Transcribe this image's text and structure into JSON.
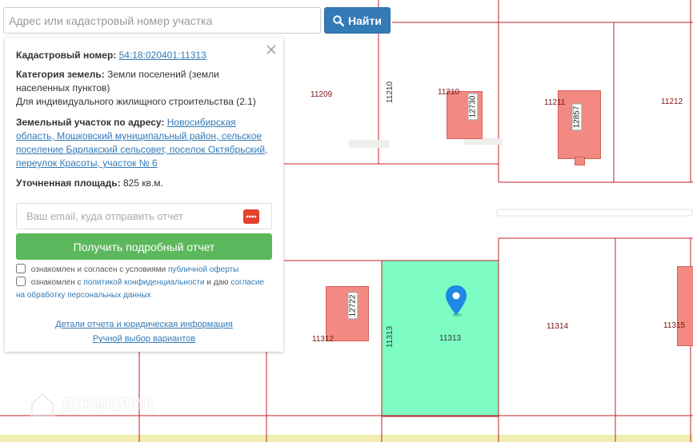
{
  "search": {
    "placeholder": "Адрес или кадастровый номер участка",
    "button_label": "Найти"
  },
  "panel": {
    "cadastral_label": "Кадастровый номер:",
    "cadastral_value": "54:18:020401:11313",
    "category_label": "Категория земель:",
    "category_value": "Земли поселений (земли населенных пунктов)",
    "category_purpose": "Для индивидуального жилищного строительства (2.1)",
    "address_label": "Земельный участок по адресу:",
    "address_value": "Новосибирская область, Мошковский муниципальный район, сельское поселение Барлакский сельсовет, поселок Октябрьский, переулок Красоты, участок № 6",
    "area_label": "Уточненная площадь:",
    "area_value": "825 кв.м.",
    "email_placeholder": "Ваш email, куда отправить отчет",
    "report_button": "Получить подробный отчет",
    "consent1_text": "ознакомлен и согласен с условиями",
    "consent1_link": "публичной оферты",
    "consent2_text": "ознакомлен с",
    "consent2_link": "политикой конфиденциальности",
    "consent2_mid": "и даю",
    "consent2_link2": "согласие на обработку персональных данных",
    "details_link": "Детали отчета и юридическая информация",
    "manual_link": "Ручной выбор вариантов"
  },
  "map": {
    "parcels": [
      "11209",
      "11210",
      "11211",
      "11212",
      "11312",
      "11313",
      "11314",
      "11315"
    ],
    "buildings": [
      "12730",
      "12857",
      "12722"
    ],
    "side_label": "11313",
    "selected_color": "#7dfcc3",
    "building_color": "#f28a82",
    "border_color": "#c0202a"
  },
  "watermark": "ДОМКЛИК"
}
